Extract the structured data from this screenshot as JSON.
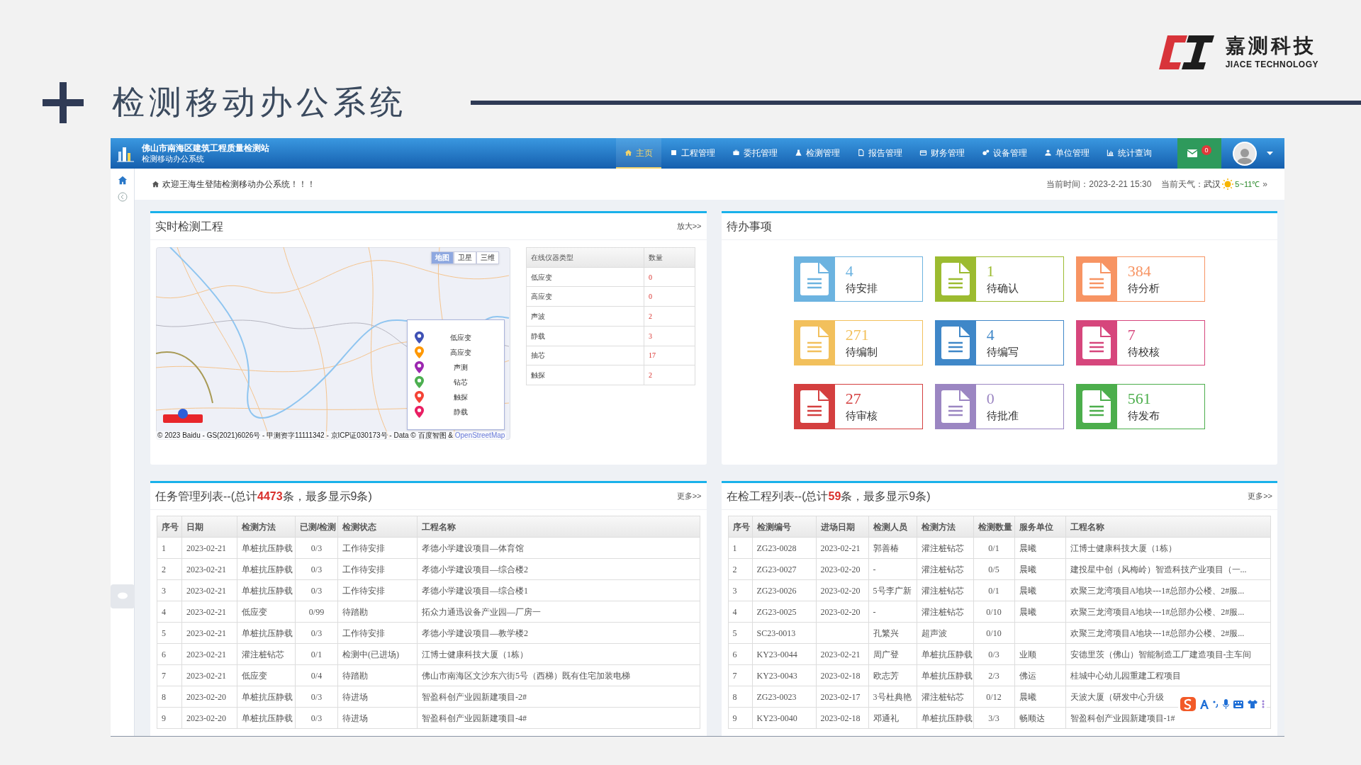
{
  "slide": {
    "title": "检测移动办公系统",
    "logo_cn": "嘉测科技",
    "logo_en": "JIACE TECHNOLOGY"
  },
  "app": {
    "org": "佛山市南海区建筑工程质量检测站",
    "subtitle": "检测移动办公系统"
  },
  "nav": [
    {
      "label": "主页",
      "selected": true
    },
    {
      "label": "工程管理",
      "selected": false
    },
    {
      "label": "委托管理",
      "selected": false
    },
    {
      "label": "检测管理",
      "selected": false
    },
    {
      "label": "报告管理",
      "selected": false
    },
    {
      "label": "财务管理",
      "selected": false
    },
    {
      "label": "设备管理",
      "selected": false
    },
    {
      "label": "单位管理",
      "selected": false
    },
    {
      "label": "统计查询",
      "selected": false
    }
  ],
  "mail_badge": "0",
  "welcome": "欢迎王海生登陆检测移动办公系统！！！",
  "time": "当前时间：2023-2-21 15:30",
  "weather_label": "当前天气：",
  "city": "武汉",
  "temperature": "5~11℃",
  "weather_more": "»",
  "map_panel": {
    "title": "实时检测工程",
    "link": "放大>>",
    "map_types": [
      {
        "label": "地图",
        "selected": true
      },
      {
        "label": "卫星",
        "selected": false
      },
      {
        "label": "三维",
        "selected": false
      }
    ],
    "legend": [
      {
        "label": "低应变",
        "color": "#3f51b5"
      },
      {
        "label": "高应变",
        "color": "#ff9800"
      },
      {
        "label": "声测",
        "color": "#9c27b0"
      },
      {
        "label": "钻芯",
        "color": "#4caf50"
      },
      {
        "label": "触探",
        "color": "#f44336"
      },
      {
        "label": "静载",
        "color": "#e91e63"
      }
    ],
    "attribution": "© 2023 Baidu - GS(2021)6026号 - 甲测资字11111342 - 京ICP证030173号 - Data © 百度智图 &",
    "attribution_link": "OpenStreetMap",
    "instruments": {
      "columns": [
        "在线仪器类型",
        "数量"
      ],
      "rows": [
        [
          "低应变",
          "0"
        ],
        [
          "高应变",
          "0"
        ],
        [
          "声波",
          "2"
        ],
        [
          "静载",
          "3"
        ],
        [
          "抽芯",
          "17"
        ],
        [
          "触探",
          "2"
        ]
      ]
    }
  },
  "todo_panel": {
    "title": "待办事项",
    "items": [
      {
        "count": "4",
        "label": "待安排",
        "color": "#6cb3e0"
      },
      {
        "count": "1",
        "label": "待确认",
        "color": "#9cbb30"
      },
      {
        "count": "384",
        "label": "待分析",
        "color": "#f79463"
      },
      {
        "count": "271",
        "label": "待编制",
        "color": "#f2c05c"
      },
      {
        "count": "4",
        "label": "待编写",
        "color": "#3f87c8"
      },
      {
        "count": "7",
        "label": "待校核",
        "color": "#d6467c"
      },
      {
        "count": "27",
        "label": "待审核",
        "color": "#d43f3f"
      },
      {
        "count": "0",
        "label": "待批准",
        "color": "#9b86c2"
      },
      {
        "count": "561",
        "label": "待发布",
        "color": "#4cae4c"
      }
    ]
  },
  "task_list": {
    "title": "任务管理列表--(总计**4473**条，最多显示9条)",
    "link": "更多>>",
    "columns": [
      "序号",
      "日期",
      "检测方法",
      "已测/检测",
      "检测状态",
      "工程名称"
    ],
    "rows": [
      [
        "1",
        "2023-02-21",
        "单桩抗压静载",
        "0/3",
        "工作待安排",
        "孝德小学建设项目—体育馆"
      ],
      [
        "2",
        "2023-02-21",
        "单桩抗压静载",
        "0/3",
        "工作待安排",
        "孝德小学建设项目—综合楼2"
      ],
      [
        "3",
        "2023-02-21",
        "单桩抗压静载",
        "0/3",
        "工作待安排",
        "孝德小学建设项目—综合楼1"
      ],
      [
        "4",
        "2023-02-21",
        "低应变",
        "0/99",
        "待踏勘",
        "拓众力通迅设备产业园—厂房一"
      ],
      [
        "5",
        "2023-02-21",
        "单桩抗压静载",
        "0/3",
        "工作待安排",
        "孝德小学建设项目—教学楼2"
      ],
      [
        "6",
        "2023-02-21",
        "灌注桩钻芯",
        "0/1",
        "检测中(已进场)",
        "江博士健康科技大厦（1栋）"
      ],
      [
        "7",
        "2023-02-21",
        "低应变",
        "0/4",
        "待踏勘",
        "佛山市南海区文沙东六街5号（西梯）既有住宅加装电梯"
      ],
      [
        "8",
        "2023-02-20",
        "单桩抗压静载",
        "0/3",
        "待进场",
        "智盈科创产业园新建项目-2#"
      ],
      [
        "9",
        "2023-02-20",
        "单桩抗压静载",
        "0/3",
        "待进场",
        "智盈科创产业园新建项目-4#"
      ]
    ]
  },
  "project_list": {
    "title": "在检工程列表--(总计**59**条，最多显示9条)",
    "link": "更多>>",
    "columns": [
      "序号",
      "检测编号",
      "进场日期",
      "检测人员",
      "检测方法",
      "检测数量",
      "服务单位",
      "工程名称"
    ],
    "rows": [
      [
        "1",
        "ZG23-0028",
        "2023-02-21",
        "郭善椿",
        "灌注桩钻芯",
        "0/1",
        "晨曦",
        "江博士健康科技大厦（1栋）"
      ],
      [
        "2",
        "ZG23-0027",
        "2023-02-20",
        "-",
        "灌注桩钻芯",
        "0/5",
        "晨曦",
        "建投星中创（风梅岭）智造科技产业项目（一..."
      ],
      [
        "3",
        "ZG23-0026",
        "2023-02-20",
        "5号李广新",
        "灌注桩钻芯",
        "0/1",
        "晨曦",
        "欢聚三龙湾项目A地块---1#总部办公楼、2#服..."
      ],
      [
        "4",
        "ZG23-0025",
        "2023-02-20",
        "-",
        "灌注桩钻芯",
        "0/10",
        "晨曦",
        "欢聚三龙湾项目A地块---1#总部办公楼、2#服..."
      ],
      [
        "5",
        "SC23-0013",
        null,
        "孔繁兴",
        "超声波",
        "0/10",
        null,
        "欢聚三龙湾项目A地块---1#总部办公楼、2#服..."
      ],
      [
        "6",
        "KY23-0044",
        "2023-02-21",
        "周广登",
        "单桩抗压静载",
        "0/3",
        "业顺",
        "安德里茨（佛山）智能制造工厂建造项目-主车间"
      ],
      [
        "7",
        "KY23-0043",
        "2023-02-18",
        "欧志芳",
        "单桩抗压静载",
        "2/3",
        "佛运",
        "桂城中心幼儿园重建工程项目"
      ],
      [
        "8",
        "ZG23-0023",
        "2023-02-17",
        "3号杜典艳",
        "灌注桩钻芯",
        "0/12",
        "晨曦",
        "天波大厦（研发中心升级"
      ],
      [
        "9",
        "KY23-0040",
        "2023-02-18",
        "邓通礼",
        "单桩抗压静载",
        "3/3",
        "畅顺达",
        "智盈科创产业园新建项目-1#"
      ]
    ]
  }
}
